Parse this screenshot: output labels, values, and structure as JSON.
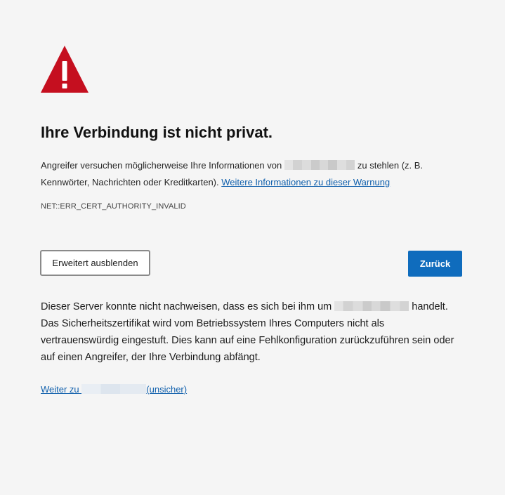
{
  "icon": "warning-triangle-icon",
  "colors": {
    "warning": "#c50f1f",
    "primary_button": "#0f6cbd",
    "link": "#0f5fac",
    "background": "#f5f5f5"
  },
  "heading": "Ihre Verbindung ist nicht privat.",
  "summary": {
    "before_host": "Angreifer versuchen möglicherweise Ihre Informationen von",
    "after_host": "zu stehlen (z. B. Kennwörter, Nachrichten oder Kreditkarten).",
    "learn_more_link": "Weitere Informationen zu dieser Warnung"
  },
  "error_code": "NET::ERR_CERT_AUTHORITY_INVALID",
  "buttons": {
    "advanced": "Erweitert ausblenden",
    "back": "Zurück"
  },
  "details": {
    "before_host": "Dieser Server konnte nicht nachweisen, dass es sich bei ihm um",
    "after_host": "handelt. Das Sicherheitszertifikat wird vom Betriebssystem Ihres Computers nicht als vertrauenswürdig eingestuft. Dies kann auf eine Fehlkonfiguration zurückzuführen sein oder auf einen Angreifer, der Ihre Verbindung abfängt."
  },
  "proceed_link": {
    "prefix": "Weiter zu",
    "suffix": "(unsicher)"
  }
}
